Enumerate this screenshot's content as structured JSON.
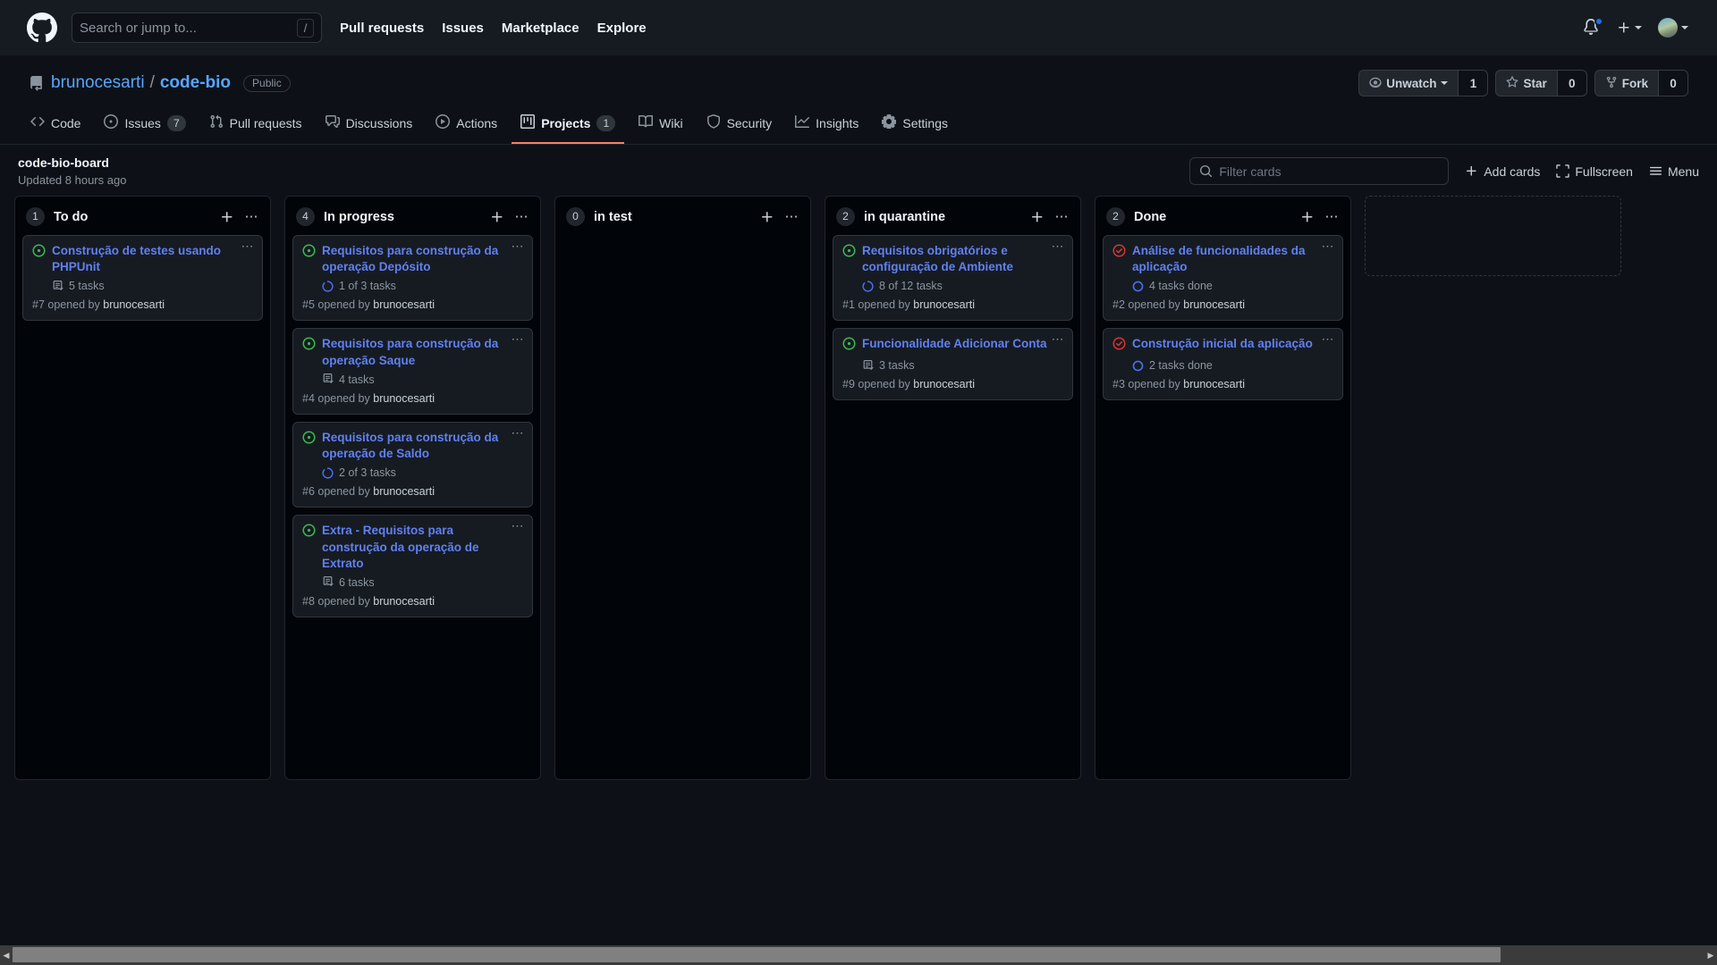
{
  "header": {
    "logo_icon": "github-logo-icon",
    "search": {
      "placeholder": "Search or jump to...",
      "value": "",
      "shortcut_key": "/"
    },
    "nav": [
      {
        "label": "Pull requests"
      },
      {
        "label": "Issues"
      },
      {
        "label": "Marketplace"
      },
      {
        "label": "Explore"
      }
    ],
    "notifications_icon": "bell-icon",
    "create_new_icon": "plus-icon",
    "avatar_icon": "avatar"
  },
  "repo": {
    "icon": "repo-icon",
    "owner": "brunocesarti",
    "separator": "/",
    "name": "code-bio",
    "visibility": "Public",
    "actions": [
      {
        "icon": "eye-icon",
        "label": "Unwatch",
        "count": "1",
        "has_caret": true
      },
      {
        "icon": "star-icon",
        "label": "Star",
        "count": "0",
        "has_caret": false
      },
      {
        "icon": "fork-icon",
        "label": "Fork",
        "count": "0",
        "has_caret": false
      }
    ],
    "tabs": [
      {
        "id": "code",
        "label": "Code",
        "icon": "code-icon",
        "counter": null,
        "active": false
      },
      {
        "id": "issues",
        "label": "Issues",
        "icon": "issue-opened-icon",
        "counter": "7",
        "active": false
      },
      {
        "id": "pull-requests",
        "label": "Pull requests",
        "icon": "git-pull-request-icon",
        "counter": null,
        "active": false
      },
      {
        "id": "discussions",
        "label": "Discussions",
        "icon": "comment-discussion-icon",
        "counter": null,
        "active": false
      },
      {
        "id": "actions",
        "label": "Actions",
        "icon": "play-icon",
        "counter": null,
        "active": false
      },
      {
        "id": "projects",
        "label": "Projects",
        "icon": "project-icon",
        "counter": "1",
        "active": true
      },
      {
        "id": "wiki",
        "label": "Wiki",
        "icon": "book-icon",
        "counter": null,
        "active": false
      },
      {
        "id": "security",
        "label": "Security",
        "icon": "shield-icon",
        "counter": null,
        "active": false
      },
      {
        "id": "insights",
        "label": "Insights",
        "icon": "graph-icon",
        "counter": null,
        "active": false
      },
      {
        "id": "settings",
        "label": "Settings",
        "icon": "gear-icon",
        "counter": null,
        "active": false
      }
    ]
  },
  "project": {
    "title": "code-bio-board",
    "updated": "Updated 8 hours ago",
    "filter": {
      "placeholder": "Filter cards",
      "value": "",
      "icon": "search-icon"
    },
    "tools": [
      {
        "id": "add-cards",
        "label": "Add cards",
        "icon": "plus-icon"
      },
      {
        "id": "fullscreen",
        "label": "Fullscreen",
        "icon": "fullscreen-icon"
      },
      {
        "id": "menu",
        "label": "Menu",
        "icon": "hamburger-icon"
      }
    ]
  },
  "colors": {
    "issue_open": "#3fb950",
    "issue_closed": "#da3633",
    "task_progress": "#4c6ef5",
    "task_done": "#4c6ef5",
    "card_title": "#6080f0",
    "active_tab_underline": "#f78166"
  },
  "board": {
    "columns": [
      {
        "id": "to-do",
        "name": "To do",
        "count": "1",
        "cards": [
          {
            "state": "open",
            "title": "Construção de testes usando PHPUnit",
            "tasks_icon": "checklist-icon",
            "tasks": "5 tasks",
            "number": "#7",
            "meta_prefix": "#7 opened by ",
            "author": "brunocesarti"
          }
        ]
      },
      {
        "id": "in-progress",
        "name": "In progress",
        "count": "4",
        "cards": [
          {
            "state": "open",
            "title": "Requisitos para construção da operação Depósito",
            "tasks_icon": "progress-icon",
            "tasks": "1 of 3 tasks",
            "number": "#5",
            "meta_prefix": "#5 opened by ",
            "author": "brunocesarti"
          },
          {
            "state": "open",
            "title": "Requisitos para construção da operação Saque",
            "tasks_icon": "checklist-icon",
            "tasks": "4 tasks",
            "number": "#4",
            "meta_prefix": "#4 opened by ",
            "author": "brunocesarti"
          },
          {
            "state": "open",
            "title": "Requisitos para construção da operação de Saldo",
            "tasks_icon": "progress-icon",
            "tasks": "2 of 3 tasks",
            "number": "#6",
            "meta_prefix": "#6 opened by ",
            "author": "brunocesarti"
          },
          {
            "state": "open",
            "title": "Extra - Requisitos para construção da operação de Extrato",
            "tasks_icon": "checklist-icon",
            "tasks": "6 tasks",
            "number": "#8",
            "meta_prefix": "#8 opened by ",
            "author": "brunocesarti"
          }
        ]
      },
      {
        "id": "in-test",
        "name": "in test",
        "count": "0",
        "cards": []
      },
      {
        "id": "in-quarantine",
        "name": "in quarantine",
        "count": "2",
        "cards": [
          {
            "state": "open",
            "title": "Requisitos obrigatórios e configuração de Ambiente",
            "tasks_icon": "progress-icon",
            "tasks": "8 of 12 tasks",
            "number": "#1",
            "meta_prefix": "#1 opened by ",
            "author": "brunocesarti"
          },
          {
            "state": "open",
            "title": "Funcionalidade Adicionar Conta",
            "tasks_icon": "checklist-icon",
            "tasks": "3 tasks",
            "number": "#9",
            "meta_prefix": "#9 opened by ",
            "author": "brunocesarti"
          }
        ]
      },
      {
        "id": "done",
        "name": "Done",
        "count": "2",
        "cards": [
          {
            "state": "closed",
            "title": "Análise de funcionalidades da aplicação",
            "tasks_icon": "done-circle-icon",
            "tasks": "4 tasks done",
            "number": "#2",
            "meta_prefix": "#2 opened by ",
            "author": "brunocesarti"
          },
          {
            "state": "closed",
            "title": "Construção inicial da aplicação",
            "tasks_icon": "done-circle-icon",
            "tasks": "2 tasks done",
            "number": "#3",
            "meta_prefix": "#3 opened by ",
            "author": "brunocesarti"
          }
        ]
      }
    ],
    "add_column_placeholder": ""
  },
  "scrollbar": {
    "left_arrow": "◀",
    "right_arrow": "▶"
  }
}
